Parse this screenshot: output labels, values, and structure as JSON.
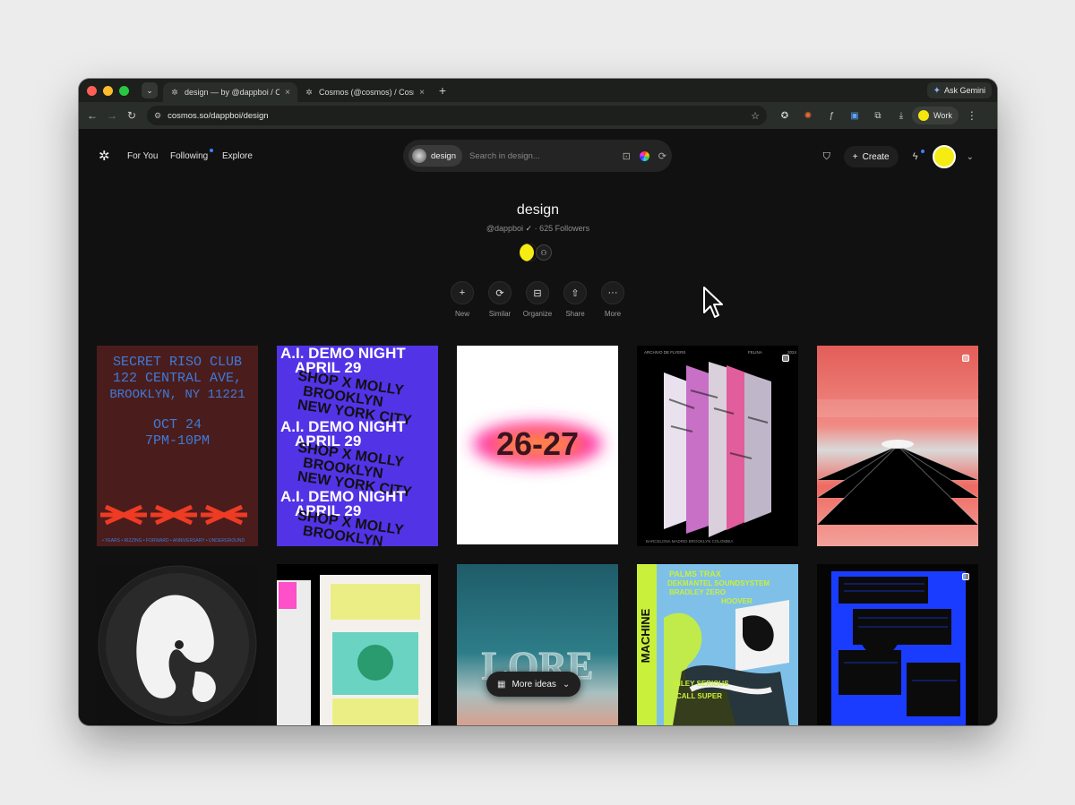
{
  "browser": {
    "tabs": [
      {
        "title": "design — by @dappboi / Cosmos",
        "active": true
      },
      {
        "title": "Cosmos (@cosmos) / Cosmos",
        "active": false
      }
    ],
    "ask_gemini": "Ask Gemini",
    "url": "cosmos.so/dappboi/design",
    "profile_label": "Work"
  },
  "nav": {
    "links": [
      "For You",
      "Following",
      "Explore"
    ],
    "search_chip": "design",
    "search_placeholder": "Search in design...",
    "create_label": "Create"
  },
  "cluster": {
    "title": "design",
    "owner": "@dappboi",
    "followers": "625 Followers",
    "separator": "·"
  },
  "actions": [
    {
      "label": "New",
      "icon": "plus-icon"
    },
    {
      "label": "Similar",
      "icon": "similar-icon"
    },
    {
      "label": "Organize",
      "icon": "organize-icon"
    },
    {
      "label": "Share",
      "icon": "share-icon"
    },
    {
      "label": "More",
      "icon": "more-dots-icon"
    }
  ],
  "posters": {
    "riso": {
      "lines": [
        "SECRET RISO CLUB",
        "122 CENTRAL AVE,",
        "BROOKLYN, NY 11221",
        "OCT 24",
        "7PM-10PM"
      ],
      "footer": "• YEARS • RIZZING • FORWARD • ANNIVERSARY • UNDERGROUND"
    },
    "demo": {
      "lines": [
        "A.I. DEMO NIGHT",
        "APRIL 29",
        "SHOP X MOLLY",
        "BROOKLYN",
        "NEW YORK CITY"
      ]
    },
    "year": {
      "text": "26-27"
    },
    "archive": {
      "header_left": "ARCHIVO DE FLYERS",
      "header_mid": "FELINA",
      "header_right": "2024",
      "footer": "BARCELONA MADRID BROOKLYN COLOMBIA"
    },
    "lore": {
      "text": "LORE"
    },
    "machine": {
      "title": "MACHINE",
      "lines": [
        "PALMS TRAX",
        "DEKMANTEL SOUNDSYSTEM",
        "BRADLEY ZERO",
        "HOOVER",
        "MILEY SERIOUS",
        "CALL SUPER"
      ]
    }
  },
  "more_ideas": "More ideas",
  "colors": {
    "accent_yellow": "#f5ec13",
    "notification_blue": "#3b82f6"
  }
}
